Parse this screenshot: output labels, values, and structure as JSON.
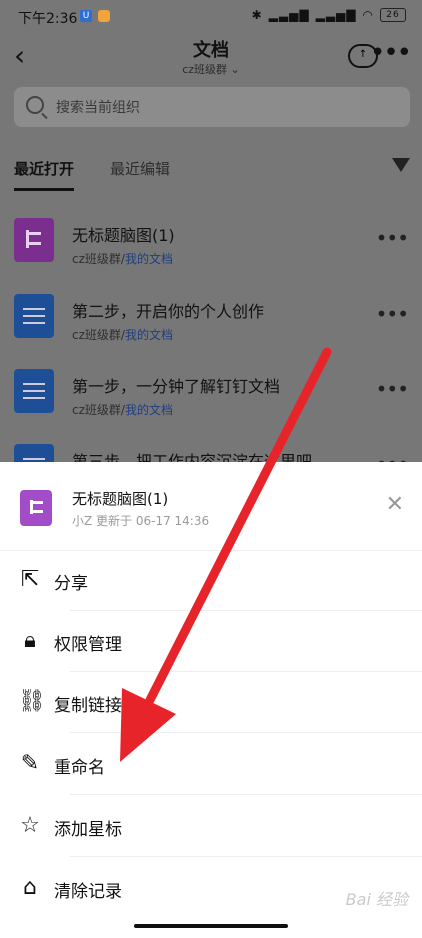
{
  "status": {
    "time": "下午2:36",
    "battery": "26"
  },
  "header": {
    "title": "文档",
    "subtitle": "cz班级群 ⌄"
  },
  "search": {
    "placeholder": "搜索当前组织"
  },
  "tabs": [
    {
      "label": "最近打开"
    },
    {
      "label": "最近编辑"
    }
  ],
  "list": [
    {
      "title": "无标题脑图(1)",
      "group": "cz班级群/",
      "folder": "我的文档",
      "type": "mindmap"
    },
    {
      "title": "第二步，开启你的个人创作",
      "group": "cz班级群/",
      "folder": "我的文档",
      "type": "doc"
    },
    {
      "title": "第一步，一分钟了解钉钉文档",
      "group": "cz班级群/",
      "folder": "我的文档",
      "type": "doc"
    },
    {
      "title": "第三步，把工作内容沉淀在这里吧",
      "type": "doc"
    }
  ],
  "sheet": {
    "title": "无标题脑图(1)",
    "meta": "小Z 更新于 06-17 14:36",
    "actions": [
      {
        "label": "分享",
        "icon": "share-icon"
      },
      {
        "label": "权限管理",
        "icon": "lock-icon"
      },
      {
        "label": "复制链接",
        "icon": "link-icon"
      },
      {
        "label": "重命名",
        "icon": "edit-icon"
      },
      {
        "label": "添加星标",
        "icon": "star-icon"
      },
      {
        "label": "清除记录",
        "icon": "clear-icon"
      }
    ]
  },
  "watermark": "Bai 经验",
  "colors": {
    "arrow": "#e8242b",
    "mindmap_purple": "#a24cc7",
    "doc_blue": "#2a6fd6"
  }
}
